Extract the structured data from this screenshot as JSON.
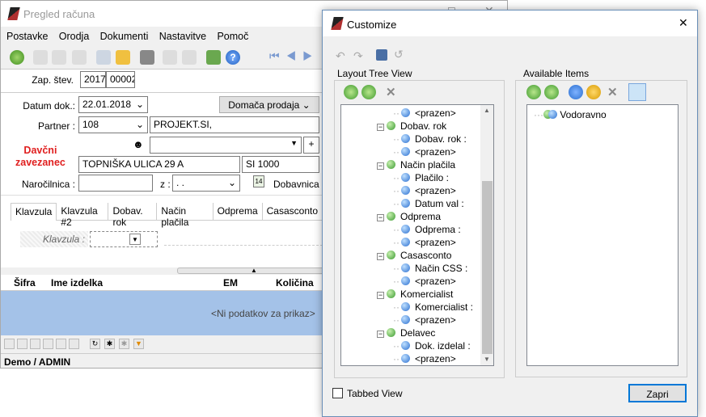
{
  "main": {
    "title": "Pregled računa",
    "menu": [
      "Postavke",
      "Orodja",
      "Dokumenti",
      "Nastavitve",
      "Pomoč"
    ],
    "zap_label": "Zap. štev.",
    "zap_year": "2017",
    "zap_num": "00002",
    "datum_label": "Datum dok.:",
    "datum_value": "22.01.2018",
    "doc_type": "Domača prodaja",
    "partner_label": "Partner :",
    "partner_code": "108",
    "partner_name": "PROJEKT.SI,",
    "tax_label_1": "Davčni",
    "tax_label_2": "zavezanec",
    "address": "TOPNIŠKA ULICA 29 A",
    "postal": "SI 1000",
    "narocilnica_label": "Naročilnica :",
    "z_label": "z :",
    "z_value": ". .",
    "dobavnica_label": "Dobavnica :",
    "calendar_day": "14",
    "tabs": [
      "Klavzula",
      "Klavzula #2",
      "Dobav. rok",
      "Način plačila",
      "Odprema",
      "Casasconto"
    ],
    "klavzula_label": "Klavzula :",
    "grid_cols": [
      "Šifra",
      "Ime izdelka",
      "EM",
      "Količina"
    ],
    "empty_text": "<Ni podatkov za prikaz>",
    "status": "Demo / ADMIN"
  },
  "dialog": {
    "title": "Customize",
    "layout_title": "Layout Tree View",
    "available_title": "Available Items",
    "tree": [
      {
        "label": "<prazen>",
        "level": 2
      },
      {
        "label": "Dobav. rok",
        "level": 1
      },
      {
        "label": "Dobav. rok :",
        "level": 2
      },
      {
        "label": "<prazen>",
        "level": 2
      },
      {
        "label": "Način plačila",
        "level": 1
      },
      {
        "label": "Plačilo :",
        "level": 2
      },
      {
        "label": "<prazen>",
        "level": 2
      },
      {
        "label": "Datum val :",
        "level": 2
      },
      {
        "label": "Odprema",
        "level": 1
      },
      {
        "label": "Odprema :",
        "level": 2
      },
      {
        "label": "<prazen>",
        "level": 2
      },
      {
        "label": "Casasconto",
        "level": 1
      },
      {
        "label": "Način CSS :",
        "level": 2
      },
      {
        "label": "<prazen>",
        "level": 2
      },
      {
        "label": "Komercialist",
        "level": 1
      },
      {
        "label": "Komercialist :",
        "level": 2
      },
      {
        "label": "<prazen>",
        "level": 2
      },
      {
        "label": "Delavec",
        "level": 1
      },
      {
        "label": "Dok. izdelal :",
        "level": 2
      },
      {
        "label": "<prazen>",
        "level": 2
      }
    ],
    "available": [
      "Vodoravno"
    ],
    "tabbed_view": "Tabbed View",
    "close_button": "Zapri",
    "colors": {
      "accent": "#2a6fd0",
      "group": "#3a9a30"
    }
  }
}
